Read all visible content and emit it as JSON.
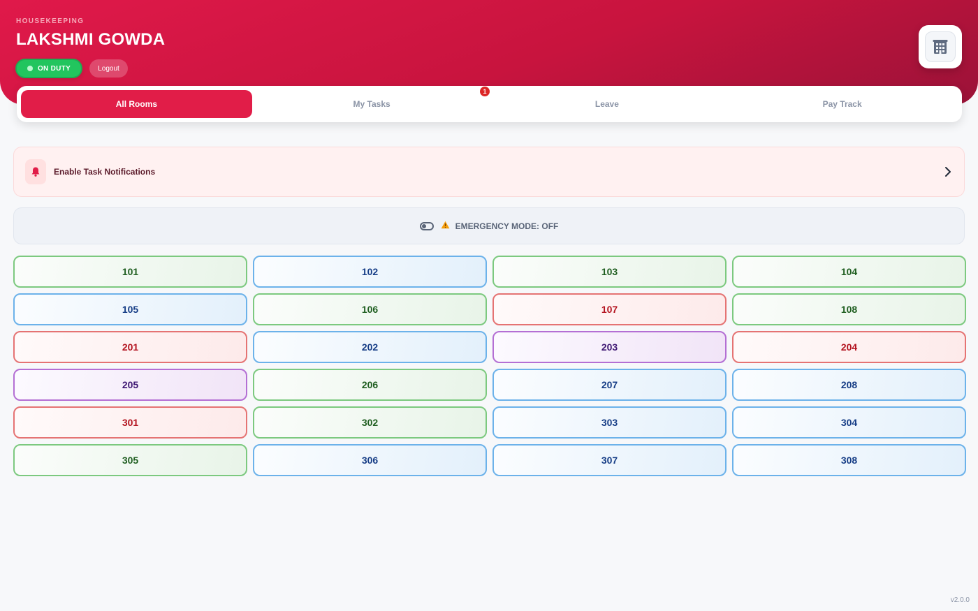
{
  "header": {
    "department": "HOUSEKEEPING",
    "staff_name": "LAKSHMI GOWDA",
    "duty_label": "ON DUTY",
    "logout_label": "Logout",
    "hotel_icon": "building-icon"
  },
  "tabs": [
    {
      "label": "All Rooms",
      "active": true
    },
    {
      "label": "My Tasks",
      "active": false
    },
    {
      "label": "Leave",
      "active": false
    },
    {
      "label": "Pay Track",
      "active": false
    }
  ],
  "tasks_badge": "1",
  "notification": {
    "label": "Enable Task Notifications",
    "icon": "bell-icon"
  },
  "emergency": {
    "label": "EMERGENCY MODE: OFF"
  },
  "rooms": [
    {
      "number": "101",
      "status": "green"
    },
    {
      "number": "102",
      "status": "blue"
    },
    {
      "number": "103",
      "status": "green"
    },
    {
      "number": "104",
      "status": "green"
    },
    {
      "number": "105",
      "status": "blue"
    },
    {
      "number": "106",
      "status": "green"
    },
    {
      "number": "107",
      "status": "red"
    },
    {
      "number": "108",
      "status": "green"
    },
    {
      "number": "201",
      "status": "red"
    },
    {
      "number": "202",
      "status": "blue"
    },
    {
      "number": "203",
      "status": "purple"
    },
    {
      "number": "204",
      "status": "red"
    },
    {
      "number": "205",
      "status": "purple"
    },
    {
      "number": "206",
      "status": "green"
    },
    {
      "number": "207",
      "status": "blue"
    },
    {
      "number": "208",
      "status": "blue"
    },
    {
      "number": "301",
      "status": "red"
    },
    {
      "number": "302",
      "status": "green"
    },
    {
      "number": "303",
      "status": "blue"
    },
    {
      "number": "304",
      "status": "blue"
    },
    {
      "number": "305",
      "status": "green"
    },
    {
      "number": "306",
      "status": "blue"
    },
    {
      "number": "307",
      "status": "blue"
    },
    {
      "number": "308",
      "status": "blue"
    }
  ],
  "colors": {
    "brand": "#e11d48",
    "on_duty": "#22c55e",
    "green": "#7cc97f",
    "blue": "#6cb2ea",
    "red": "#e57373",
    "purple": "#b46fd4"
  },
  "version": "v2.0.0"
}
